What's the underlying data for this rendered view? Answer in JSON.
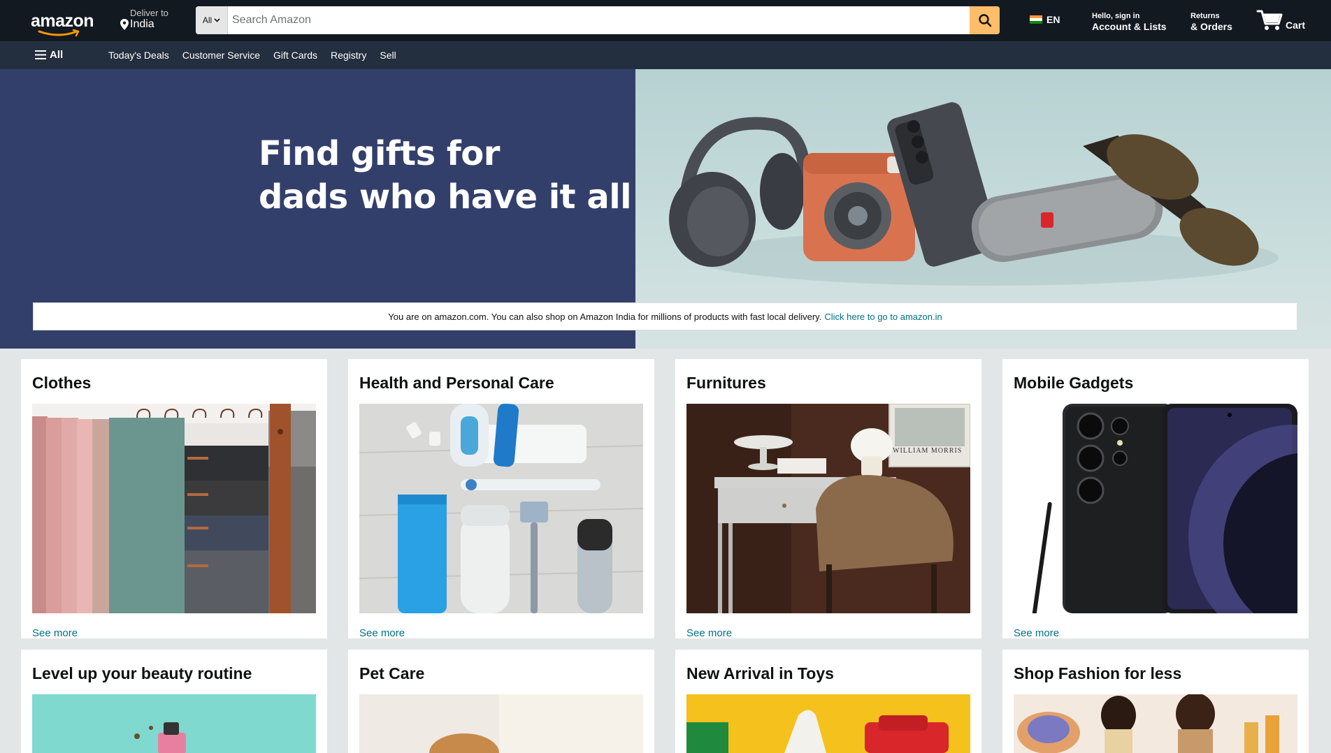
{
  "header": {
    "logo_text": "amazon",
    "deliver_label": "Deliver to",
    "deliver_location": "India",
    "search": {
      "category": "All",
      "placeholder": "Search Amazon"
    },
    "language": "EN",
    "account": {
      "greeting": "Hello, sign in",
      "label": "Account & Lists"
    },
    "returns": {
      "line1": "Returns",
      "line2": "& Orders"
    },
    "cart_label": "Cart"
  },
  "subnav": {
    "all_label": "All",
    "links": [
      "Today's Deals",
      "Customer Service",
      "Gift Cards",
      "Registry",
      "Sell"
    ]
  },
  "hero": {
    "title_line1": "Find gifts for",
    "title_line2": "dads who have it all",
    "notice_text": "You are on amazon.com. You can also shop on Amazon India for millions of products with fast local delivery.",
    "notice_link": "Click here to go to amazon.in"
  },
  "cards": [
    {
      "title": "Clothes",
      "link": "See more"
    },
    {
      "title": "Health and Personal Care",
      "link": "See more"
    },
    {
      "title": "Furnitures",
      "link": "See more"
    },
    {
      "title": "Mobile Gadgets",
      "link": "See more"
    },
    {
      "title": "Level up your beauty routine"
    },
    {
      "title": "Pet Care"
    },
    {
      "title": "New Arrival in Toys"
    },
    {
      "title": "Shop Fashion for less"
    }
  ],
  "furniture_poster_text": "WILLIAM MORRIS",
  "colors": {
    "nav_dark": "#131921",
    "nav_sub": "#232f3e",
    "search_button": "#febd69",
    "hero_left": "#333f6b",
    "link": "#007185"
  }
}
